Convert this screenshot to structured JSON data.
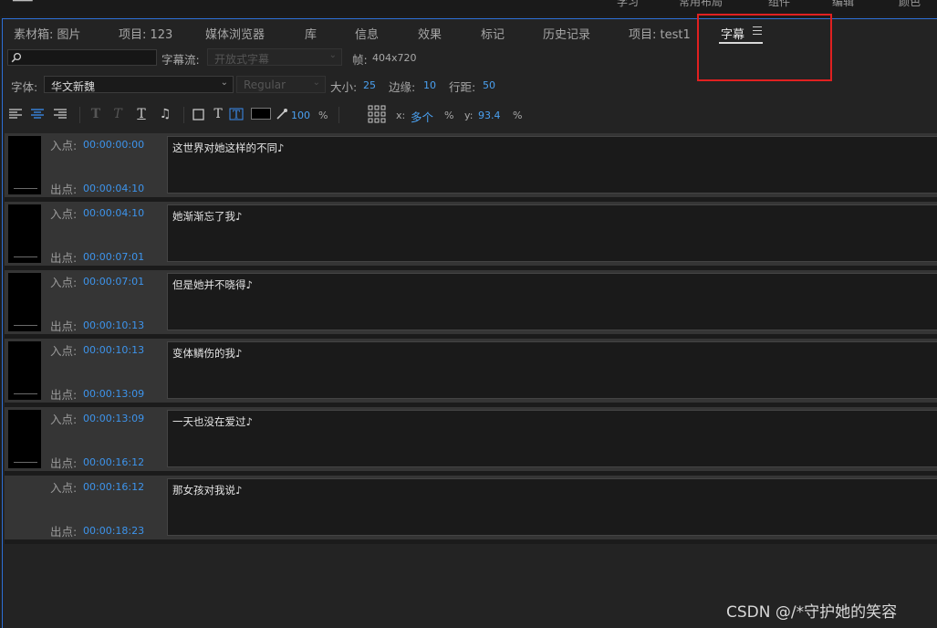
{
  "top_bar": {
    "workspaces": [
      "学习",
      "常用布局",
      "组件",
      "编辑",
      "颜色"
    ]
  },
  "tabs": [
    {
      "label": "素材箱: 图片"
    },
    {
      "label": "项目: 123"
    },
    {
      "label": "媒体浏览器"
    },
    {
      "label": "库"
    },
    {
      "label": "信息"
    },
    {
      "label": "效果"
    },
    {
      "label": "标记"
    },
    {
      "label": "历史记录"
    },
    {
      "label": "项目: test1"
    },
    {
      "label": "字幕"
    }
  ],
  "controls": {
    "search_placeholder": "",
    "stream_label": "字幕流:",
    "stream_value": "开放式字幕",
    "frame_label": "帧:",
    "frame_value": "404x720",
    "font_label": "字体:",
    "font_value": "华文新魏",
    "style_value": "Regular",
    "size_label": "大小:",
    "size_value": "25",
    "edge_label": "边缘:",
    "edge_value": "10",
    "line_label": "行距:",
    "line_value": "50"
  },
  "toolbar": {
    "opacity_value": "100",
    "opacity_unit": "%",
    "x_label": "x:",
    "x_value": "多个",
    "x_unit": "%",
    "y_label": "y:",
    "y_value": "93.4",
    "y_unit": "%",
    "bg_color": "#000000"
  },
  "captions": [
    {
      "in_label": "入点:",
      "in": "00:00:00:00",
      "out_label": "出点:",
      "out": "00:00:04:10",
      "text": "这世界对她这样的不同♪",
      "has_thumb": true
    },
    {
      "in_label": "入点:",
      "in": "00:00:04:10",
      "out_label": "出点:",
      "out": "00:00:07:01",
      "text": "她渐渐忘了我♪",
      "has_thumb": true
    },
    {
      "in_label": "入点:",
      "in": "00:00:07:01",
      "out_label": "出点:",
      "out": "00:00:10:13",
      "text": "但是她并不晓得♪",
      "has_thumb": true
    },
    {
      "in_label": "入点:",
      "in": "00:00:10:13",
      "out_label": "出点:",
      "out": "00:00:13:09",
      "text": "变体鳞伤的我♪",
      "has_thumb": true
    },
    {
      "in_label": "入点:",
      "in": "00:00:13:09",
      "out_label": "出点:",
      "out": "00:00:16:12",
      "text": "一天也没在爱过♪",
      "has_thumb": true
    },
    {
      "in_label": "入点:",
      "in": "00:00:16:12",
      "out_label": "出点:",
      "out": "00:00:18:23",
      "text": "那女孩对我说♪",
      "has_thumb": false
    }
  ],
  "watermark": "CSDN @/*守护她的笑容",
  "colors": {
    "accent": "#3d94ec",
    "highlight_box": "#e02020"
  }
}
